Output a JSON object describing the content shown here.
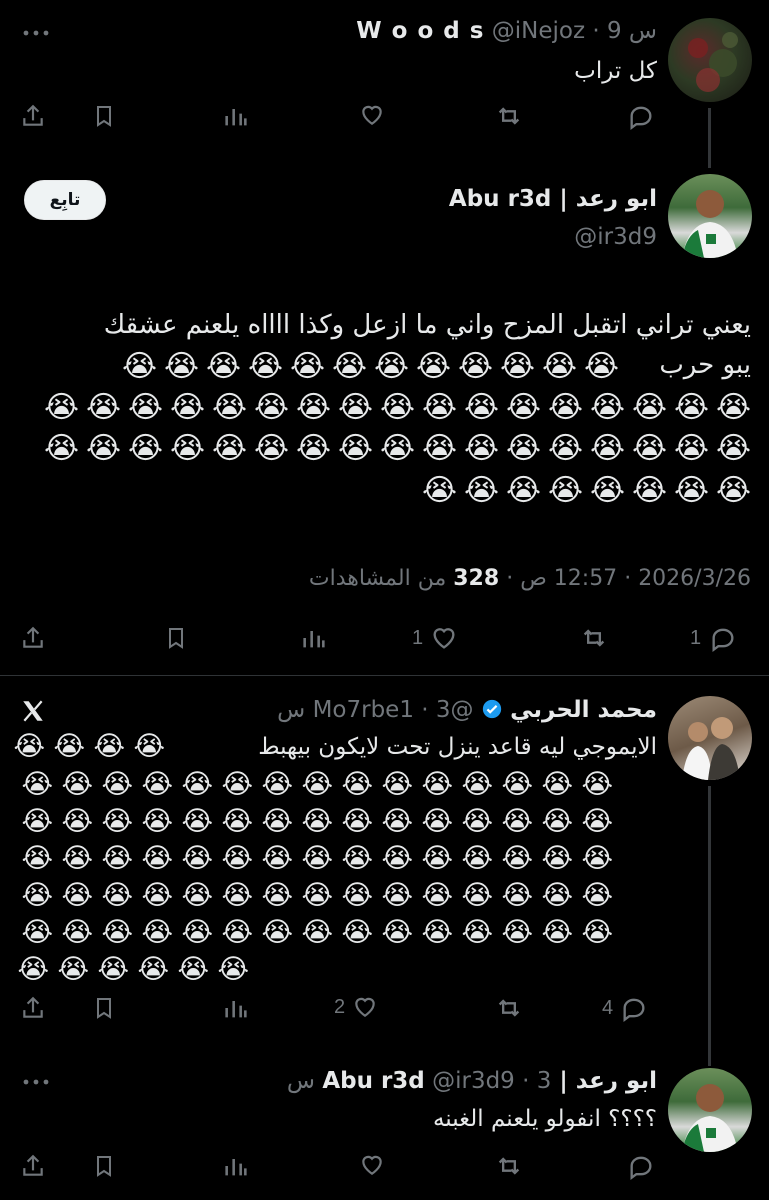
{
  "tweets": [
    {
      "name": "W o o d s",
      "handle": "@iNejoz",
      "time": "9 س",
      "text": "كل تراب",
      "stats": {
        "replies": "",
        "retweets": "",
        "likes": "",
        "views": ""
      }
    },
    {
      "name": "ابو رعد | Abu r3d",
      "handle": "@ir3d9",
      "follow_label": "تابِع",
      "text_line1": "يعني تراني اتقبل المزح واني ما ازعل وكذا ااااه يلعنم عشقك",
      "text_line2": "يبو حرب",
      "emoji": "😭",
      "date_line": {
        "date": "2026/3/26",
        "time": "12:57 ص",
        "views_count": "328",
        "views_label": "من المشاهدات"
      },
      "stats": {
        "replies": "1",
        "likes": "1"
      }
    },
    {
      "name": "محمد الحربي",
      "handle": "@Mo7rbe1",
      "time": "3 س",
      "text": "الايموجي ليه قاعد ينزل تحت لايكون بيهبط",
      "emoji": "😭",
      "stats": {
        "replies": "4",
        "likes": "2"
      }
    },
    {
      "name": "ابو رعد | Abu r3d",
      "handle": "@ir3d9",
      "time": "3 س",
      "text": "؟؟؟؟ انفولو يلعنم الغبنه"
    }
  ],
  "icons": {
    "more": "more-dots-icon",
    "reply": "reply-icon",
    "retweet": "retweet-icon",
    "like": "like-icon",
    "views": "views-icon",
    "bookmark": "bookmark-icon",
    "share": "share-icon",
    "verified": "verified-badge-icon",
    "x_logo": "x-logo-icon"
  },
  "colors": {
    "background": "#000000",
    "text": "#e7e9ea",
    "muted": "#71767b",
    "verified": "#1d9bf0"
  }
}
